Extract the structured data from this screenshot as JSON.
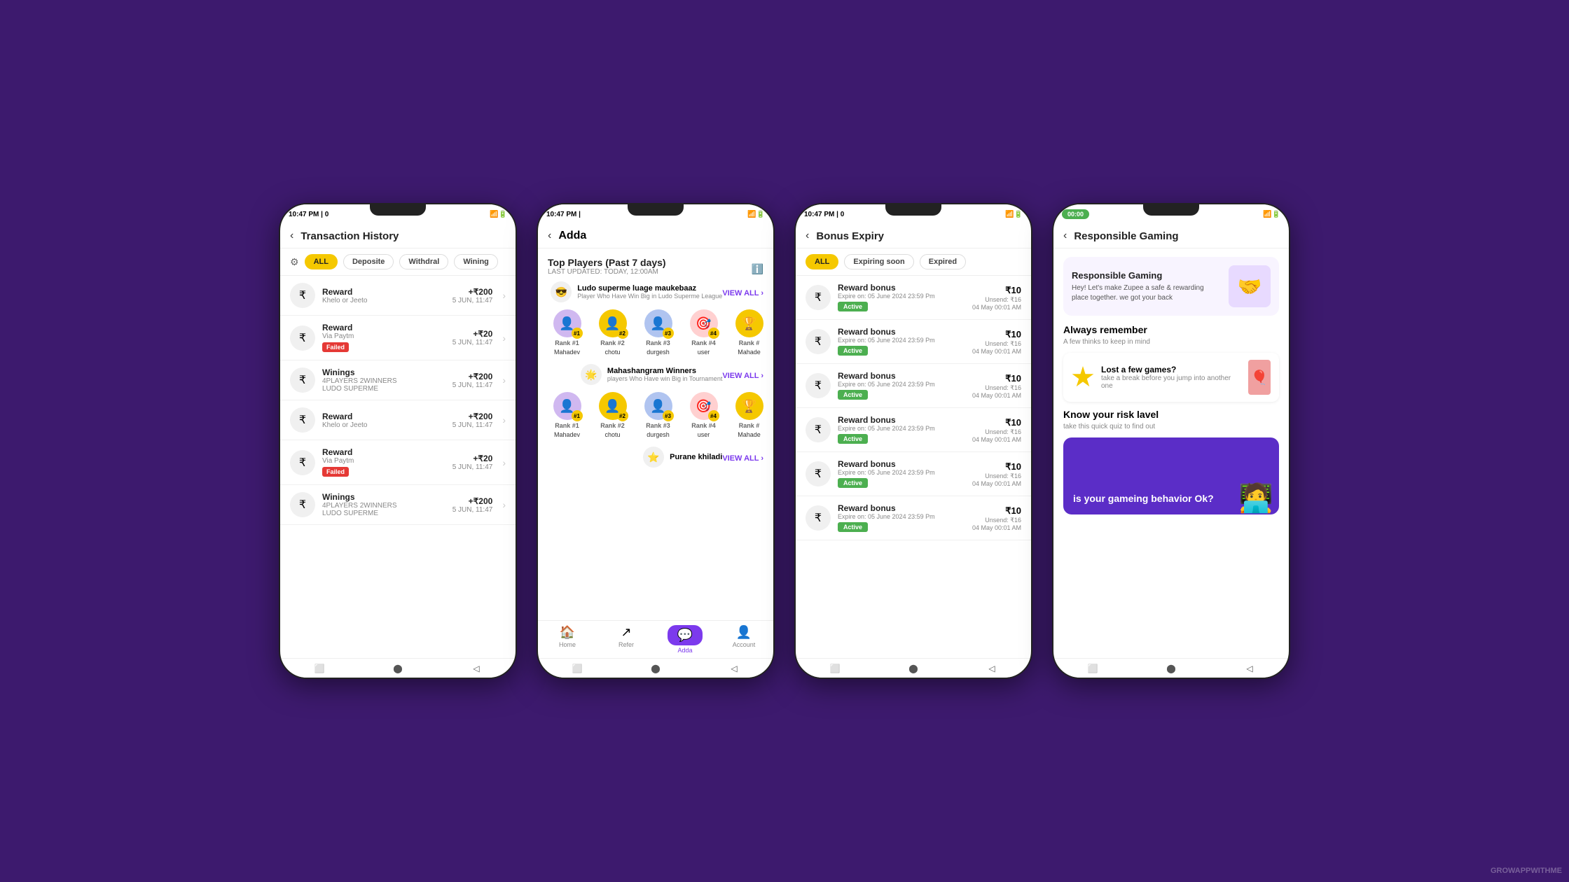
{
  "background": "#3d1a6e",
  "phone1": {
    "status_time": "10:47 PM | 0",
    "title": "Transaction History",
    "filters": [
      "ALL",
      "Deposite",
      "Withdral",
      "Wining"
    ],
    "active_filter": "ALL",
    "transactions": [
      {
        "type": "Reward",
        "sub": "Khelo or Jeeto",
        "amount": "+₹200",
        "date": "5 JUN, 11:47",
        "badge": null
      },
      {
        "type": "Reward",
        "sub": "Via Paytm",
        "amount": "+₹20",
        "date": "5 JUN, 11:47",
        "badge": "Failed"
      },
      {
        "type": "Winings",
        "sub": "4PLAYERS 2WINNERS\nLUDO SUPERME",
        "amount": "+₹200",
        "date": "5 JUN, 11:47",
        "badge": null
      },
      {
        "type": "Reward",
        "sub": "Khelo or Jeeto",
        "amount": "+₹200",
        "date": "5 JUN, 11:47",
        "badge": null
      },
      {
        "type": "Reward",
        "sub": "Via Paytm",
        "amount": "+₹20",
        "date": "5 JUN, 11:47",
        "badge": "Failed"
      },
      {
        "type": "Winings",
        "sub": "4PLAYERS 2WINNERS\nLUDO SUPERME",
        "amount": "+₹200",
        "date": "5 JUN, 11:47",
        "badge": null
      }
    ]
  },
  "phone2": {
    "status_time": "10:47 PM |",
    "title": "Adda",
    "section1": {
      "title": "Top Players (Past 7 days)",
      "last_updated": "LAST UPDATED: TODAY, 12:00AM",
      "emoji": "😎",
      "category": "Ludo superme luage maukebaaz",
      "category_sub": "Player Who Have Win Big in Ludo Superme League",
      "players": [
        {
          "rank": "Rank #1",
          "name": "Mahadev",
          "emoji": "👤"
        },
        {
          "rank": "Rank #2",
          "name": "chotu",
          "emoji": "👤"
        },
        {
          "rank": "Rank #3",
          "name": "durgesh",
          "emoji": "👤"
        },
        {
          "rank": "Rank #4",
          "name": "user",
          "emoji": "🎯"
        },
        {
          "rank": "Rank #",
          "name": "Mahade",
          "emoji": "🏆"
        }
      ]
    },
    "section2": {
      "emoji": "🌟",
      "category": "Mahashangram Winners",
      "category_sub": "players Who Have win Big in Tournament",
      "players": [
        {
          "rank": "Rank #1",
          "name": "Mahadev",
          "emoji": "👤"
        },
        {
          "rank": "Rank #2",
          "name": "chotu",
          "emoji": "👤"
        },
        {
          "rank": "Rank #3",
          "name": "durgesh",
          "emoji": "👤"
        },
        {
          "rank": "Rank #4",
          "name": "user",
          "emoji": "🎯"
        },
        {
          "rank": "Rank #",
          "name": "Mahade",
          "emoji": "🏆"
        }
      ]
    },
    "section3": {
      "emoji": "⭐",
      "category": "Purane khiladi"
    },
    "nav": [
      "Home",
      "Refer",
      "Adda",
      "Account"
    ],
    "nav_active": "Adda",
    "view_all": "VIEW ALL"
  },
  "phone3": {
    "status_time": "10:47 PM | 0",
    "title": "Bonus Expiry",
    "filters": [
      "ALL",
      "Expiring soon",
      "Expired"
    ],
    "active_filter": "ALL",
    "bonuses": [
      {
        "name": "Reward bonus",
        "expire": "Expire on: 05 June 2024 23:59 Pm",
        "amount": "₹10",
        "unsend": "Unsend: ₹16",
        "date": "04 May 00:01 AM",
        "status": "Active"
      },
      {
        "name": "Reward bonus",
        "expire": "Expire on: 05 June 2024 23:59 Pm",
        "amount": "₹10",
        "unsend": "Unsend: ₹16",
        "date": "04 May 00:01 AM",
        "status": "Active"
      },
      {
        "name": "Reward bonus",
        "expire": "Expire on: 05 June 2024 23:59 Pm",
        "amount": "₹10",
        "unsend": "Unsend: ₹16",
        "date": "04 May 00:01 AM",
        "status": "Active"
      },
      {
        "name": "Reward bonus",
        "expire": "Expire on: 05 June 2024 23:59 Pm",
        "amount": "₹10",
        "unsend": "Unsend: ₹16",
        "date": "04 May 00:01 AM",
        "status": "Active"
      },
      {
        "name": "Reward bonus",
        "expire": "Expire on: 05 June 2024 23:59 Pm",
        "amount": "₹10",
        "unsend": "Unsend: ₹16",
        "date": "04 May 00:01 AM",
        "status": "Active"
      },
      {
        "name": "Reward bonus",
        "expire": "Expire on: 05 June 2024 23:59 Pm",
        "amount": "₹10",
        "unsend": "Unsend: ₹16",
        "date": "04 May 00:01 AM",
        "status": "Active"
      }
    ]
  },
  "phone4": {
    "call_time": "00:00",
    "title": "Responsible Gaming",
    "main_card": {
      "title": "Responsible Gaming",
      "desc": "Hey! Let's make Zupee a safe & rewarding place together. we got your back",
      "emoji": "🤝"
    },
    "remember_section": {
      "title": "Always remember",
      "desc": "A few thinks to keep in mind"
    },
    "lost_card": {
      "title": "Lost a few games?",
      "desc": "take a break before you jump into another one"
    },
    "risk_section": {
      "title": "Know your risk lavel",
      "desc": "take this quick quiz to find out"
    },
    "quiz_card": {
      "text": "is your gameing behavior Ok?",
      "figure": "🧑"
    }
  },
  "watermark": "GROWAPPWITHME"
}
